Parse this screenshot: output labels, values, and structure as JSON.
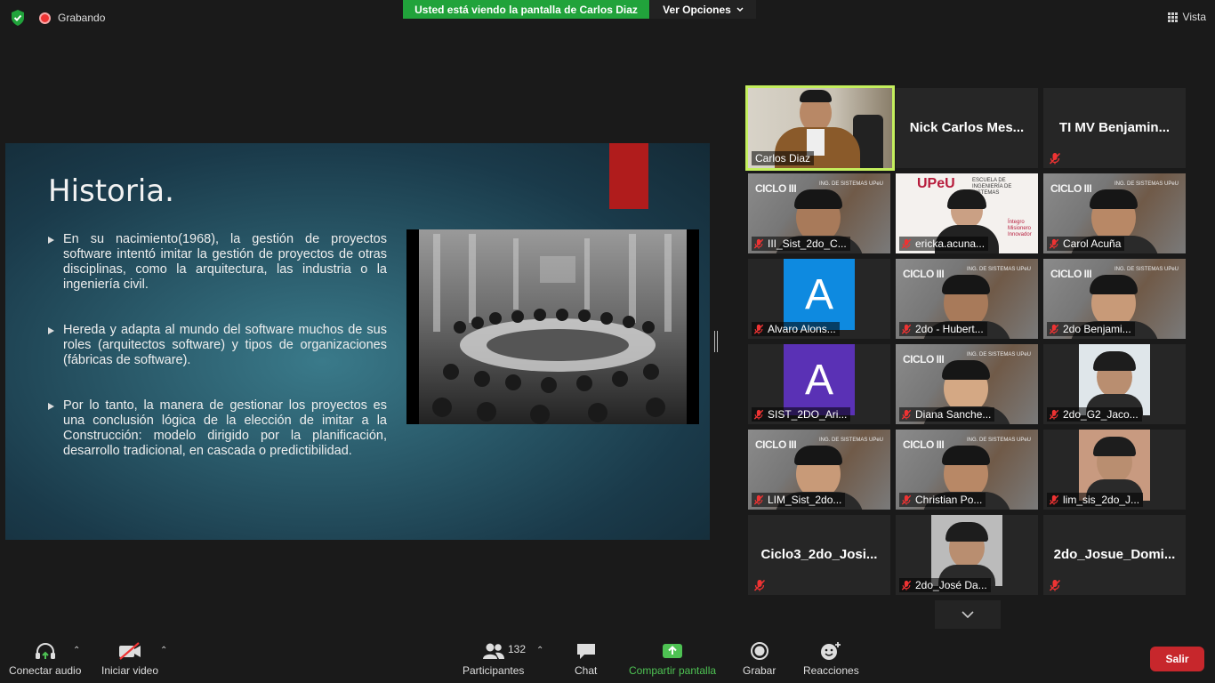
{
  "topbar": {
    "recording_label": "Grabando",
    "viewing_banner": "Usted está viendo la pantalla de Carlos Diaz",
    "options_label": "Ver Opciones",
    "view_label": "Vista",
    "colors": {
      "banner": "#21a33b",
      "shield": "#21a33b"
    }
  },
  "slide": {
    "title": "Historia.",
    "bullets": [
      "En su nacimiento(1968), la gestión de proyectos software intentó imitar la gestión de proyectos de otras disciplinas, como la arquitectura, las industria o la ingeniería civil.",
      "Hereda y adapta al mundo del software muchos de sus roles (arquitectos software) y tipos de organizaciones (fábricas de software).",
      "Por lo tanto, la manera de gestionar los proyectos es una conclusión lógica de la elección de imitar a la Construcción: modelo dirigido por la planificación, desarrollo tradicional, en cascada o predictibilidad."
    ]
  },
  "participants": {
    "tiles": [
      {
        "name": "Carlos Diaz",
        "type": "video-active",
        "muted": false
      },
      {
        "name": "Nick Carlos Mes...",
        "type": "name-only",
        "muted": false
      },
      {
        "name": "TI MV Benjamin...",
        "type": "name-only",
        "muted": true
      },
      {
        "name": "III_Sist_2do_C...",
        "type": "ciclo",
        "muted": true
      },
      {
        "name": "ericka.acuna...",
        "type": "upeu",
        "muted": true
      },
      {
        "name": "Carol Acuña",
        "type": "ciclo",
        "muted": true
      },
      {
        "name": "Alvaro Alons...",
        "type": "avatar",
        "avatar_letter": "A",
        "avatar_color": "#0e8ae0",
        "muted": true
      },
      {
        "name": "2do - Hubert...",
        "type": "ciclo",
        "muted": true
      },
      {
        "name": "2do Benjami...",
        "type": "ciclo",
        "muted": true
      },
      {
        "name": "SIST_2DO_Ari...",
        "type": "avatar",
        "avatar_letter": "A",
        "avatar_color": "#5a31b5",
        "muted": true
      },
      {
        "name": "Diana Sanche...",
        "type": "ciclo",
        "muted": true
      },
      {
        "name": "2do_G2_Jaco...",
        "type": "photo",
        "muted": true
      },
      {
        "name": "LIM_Sist_2do...",
        "type": "ciclo",
        "muted": true
      },
      {
        "name": "Christian Po...",
        "type": "ciclo",
        "muted": true
      },
      {
        "name": "lim_sis_2do_J...",
        "type": "photo",
        "muted": true
      },
      {
        "name": "Ciclo3_2do_Josi...",
        "type": "name-only",
        "muted": true
      },
      {
        "name": "2do_José Da...",
        "type": "photo",
        "muted": true
      },
      {
        "name": "2do_Josue_Domi...",
        "type": "name-only",
        "muted": true
      }
    ],
    "ciclo_label": "CICLO III",
    "upeu_label": "UPeU",
    "upeu_sub": "ESCUELA DE INGENIERÍA DE SISTEMAS",
    "upeu_lines": [
      "Íntegro",
      "Misionero",
      "Innovador"
    ],
    "banner_small": "ING. DE SISTEMAS UPeU"
  },
  "toolbar": {
    "audio_label": "Conectar audio",
    "video_label": "Iniciar video",
    "participants_label": "Participantes",
    "participants_count": "132",
    "chat_label": "Chat",
    "share_label": "Compartir pantalla",
    "record_label": "Grabar",
    "reactions_label": "Reacciones",
    "leave_label": "Salir",
    "colors": {
      "share": "#4ec253",
      "leave": "#c7272c"
    }
  }
}
